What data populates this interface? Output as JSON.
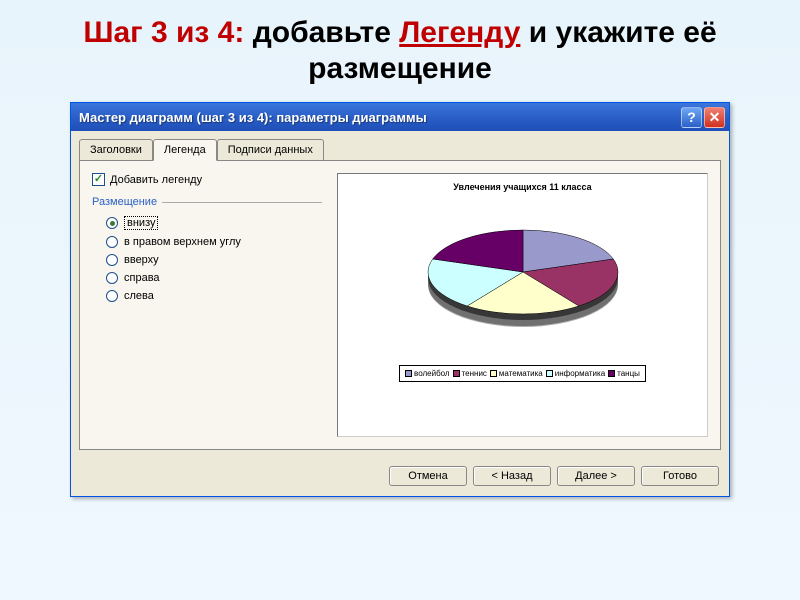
{
  "page": {
    "title_step": "Шаг 3 из 4:",
    "title_add": " добавьте ",
    "title_legend": "Легенду",
    "title_and": " и укажите её размещение"
  },
  "window": {
    "title": "Мастер диаграмм (шаг 3 из 4): параметры диаграммы",
    "help": "?",
    "close": "✕"
  },
  "tabs": {
    "headers": "Заголовки",
    "legend": "Легенда",
    "datalabels": "Подписи данных"
  },
  "panel": {
    "add_legend": "Добавить легенду",
    "placement": "Размещение",
    "radios": {
      "bottom": "внизу",
      "topright": "в правом верхнем углу",
      "top": "вверху",
      "right": "справа",
      "left": "слева"
    }
  },
  "buttons": {
    "cancel": "Отмена",
    "back": "< Назад",
    "next": "Далее >",
    "finish": "Готово"
  },
  "chart_data": {
    "type": "pie",
    "title": "Увлечения учащихся 11 класса",
    "categories": [
      "волейбол",
      "теннис",
      "математика",
      "информатика",
      "танцы"
    ],
    "values": [
      20,
      20,
      20,
      20,
      20
    ],
    "colors": [
      "#9999cc",
      "#993366",
      "#ffffcc",
      "#ccffff",
      "#660066"
    ],
    "legend_position": "bottom"
  }
}
